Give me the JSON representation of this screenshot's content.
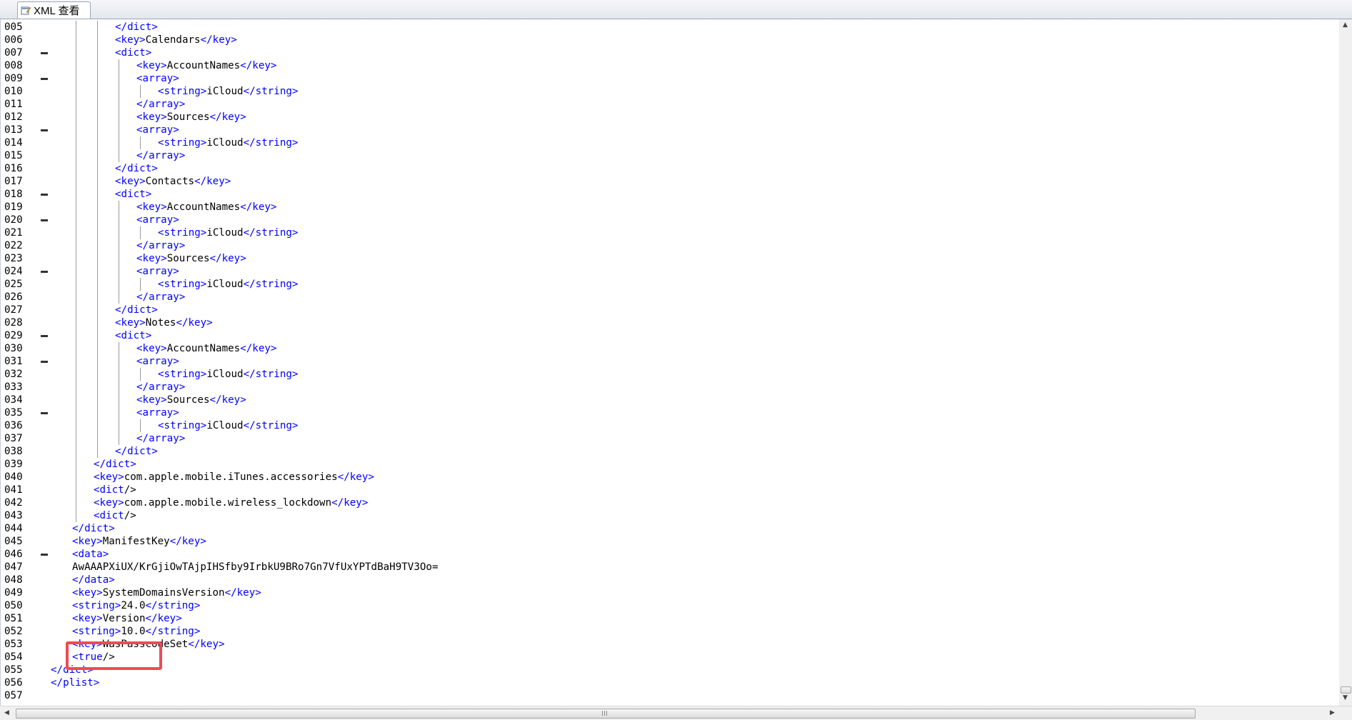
{
  "tab": {
    "label": "XML 查看",
    "icon": "document-edit-icon"
  },
  "colors": {
    "tag": "#0000ff",
    "text": "#000000",
    "highlight": "#ef4a55"
  },
  "lines": [
    {
      "num": "005",
      "indent": 5,
      "fold": false,
      "parts": [
        {
          "t": "tag",
          "v": "</dict>"
        }
      ]
    },
    {
      "num": "006",
      "indent": 5,
      "fold": false,
      "parts": [
        {
          "t": "tag",
          "v": "<key>"
        },
        {
          "t": "txt",
          "v": "Calendars"
        },
        {
          "t": "tag",
          "v": "</key>"
        }
      ]
    },
    {
      "num": "007",
      "indent": 5,
      "fold": true,
      "parts": [
        {
          "t": "tag",
          "v": "<dict>"
        }
      ]
    },
    {
      "num": "008",
      "indent": 6,
      "fold": false,
      "parts": [
        {
          "t": "tag",
          "v": "<key>"
        },
        {
          "t": "txt",
          "v": "AccountNames"
        },
        {
          "t": "tag",
          "v": "</key>"
        }
      ]
    },
    {
      "num": "009",
      "indent": 6,
      "fold": true,
      "parts": [
        {
          "t": "tag",
          "v": "<array>"
        }
      ]
    },
    {
      "num": "010",
      "indent": 7,
      "fold": false,
      "parts": [
        {
          "t": "tag",
          "v": "<string>"
        },
        {
          "t": "txt",
          "v": "iCloud"
        },
        {
          "t": "tag",
          "v": "</string>"
        }
      ]
    },
    {
      "num": "011",
      "indent": 6,
      "fold": false,
      "parts": [
        {
          "t": "tag",
          "v": "</array>"
        }
      ]
    },
    {
      "num": "012",
      "indent": 6,
      "fold": false,
      "parts": [
        {
          "t": "tag",
          "v": "<key>"
        },
        {
          "t": "txt",
          "v": "Sources"
        },
        {
          "t": "tag",
          "v": "</key>"
        }
      ]
    },
    {
      "num": "013",
      "indent": 6,
      "fold": true,
      "parts": [
        {
          "t": "tag",
          "v": "<array>"
        }
      ]
    },
    {
      "num": "014",
      "indent": 7,
      "fold": false,
      "parts": [
        {
          "t": "tag",
          "v": "<string>"
        },
        {
          "t": "txt",
          "v": "iCloud"
        },
        {
          "t": "tag",
          "v": "</string>"
        }
      ]
    },
    {
      "num": "015",
      "indent": 6,
      "fold": false,
      "parts": [
        {
          "t": "tag",
          "v": "</array>"
        }
      ]
    },
    {
      "num": "016",
      "indent": 5,
      "fold": false,
      "parts": [
        {
          "t": "tag",
          "v": "</dict>"
        }
      ]
    },
    {
      "num": "017",
      "indent": 5,
      "fold": false,
      "parts": [
        {
          "t": "tag",
          "v": "<key>"
        },
        {
          "t": "txt",
          "v": "Contacts"
        },
        {
          "t": "tag",
          "v": "</key>"
        }
      ]
    },
    {
      "num": "018",
      "indent": 5,
      "fold": true,
      "parts": [
        {
          "t": "tag",
          "v": "<dict>"
        }
      ]
    },
    {
      "num": "019",
      "indent": 6,
      "fold": false,
      "parts": [
        {
          "t": "tag",
          "v": "<key>"
        },
        {
          "t": "txt",
          "v": "AccountNames"
        },
        {
          "t": "tag",
          "v": "</key>"
        }
      ]
    },
    {
      "num": "020",
      "indent": 6,
      "fold": true,
      "parts": [
        {
          "t": "tag",
          "v": "<array>"
        }
      ]
    },
    {
      "num": "021",
      "indent": 7,
      "fold": false,
      "parts": [
        {
          "t": "tag",
          "v": "<string>"
        },
        {
          "t": "txt",
          "v": "iCloud"
        },
        {
          "t": "tag",
          "v": "</string>"
        }
      ]
    },
    {
      "num": "022",
      "indent": 6,
      "fold": false,
      "parts": [
        {
          "t": "tag",
          "v": "</array>"
        }
      ]
    },
    {
      "num": "023",
      "indent": 6,
      "fold": false,
      "parts": [
        {
          "t": "tag",
          "v": "<key>"
        },
        {
          "t": "txt",
          "v": "Sources"
        },
        {
          "t": "tag",
          "v": "</key>"
        }
      ]
    },
    {
      "num": "024",
      "indent": 6,
      "fold": true,
      "parts": [
        {
          "t": "tag",
          "v": "<array>"
        }
      ]
    },
    {
      "num": "025",
      "indent": 7,
      "fold": false,
      "parts": [
        {
          "t": "tag",
          "v": "<string>"
        },
        {
          "t": "txt",
          "v": "iCloud"
        },
        {
          "t": "tag",
          "v": "</string>"
        }
      ]
    },
    {
      "num": "026",
      "indent": 6,
      "fold": false,
      "parts": [
        {
          "t": "tag",
          "v": "</array>"
        }
      ]
    },
    {
      "num": "027",
      "indent": 5,
      "fold": false,
      "parts": [
        {
          "t": "tag",
          "v": "</dict>"
        }
      ]
    },
    {
      "num": "028",
      "indent": 5,
      "fold": false,
      "parts": [
        {
          "t": "tag",
          "v": "<key>"
        },
        {
          "t": "txt",
          "v": "Notes"
        },
        {
          "t": "tag",
          "v": "</key>"
        }
      ]
    },
    {
      "num": "029",
      "indent": 5,
      "fold": true,
      "parts": [
        {
          "t": "tag",
          "v": "<dict>"
        }
      ]
    },
    {
      "num": "030",
      "indent": 6,
      "fold": false,
      "parts": [
        {
          "t": "tag",
          "v": "<key>"
        },
        {
          "t": "txt",
          "v": "AccountNames"
        },
        {
          "t": "tag",
          "v": "</key>"
        }
      ]
    },
    {
      "num": "031",
      "indent": 6,
      "fold": true,
      "parts": [
        {
          "t": "tag",
          "v": "<array>"
        }
      ]
    },
    {
      "num": "032",
      "indent": 7,
      "fold": false,
      "parts": [
        {
          "t": "tag",
          "v": "<string>"
        },
        {
          "t": "txt",
          "v": "iCloud"
        },
        {
          "t": "tag",
          "v": "</string>"
        }
      ]
    },
    {
      "num": "033",
      "indent": 6,
      "fold": false,
      "parts": [
        {
          "t": "tag",
          "v": "</array>"
        }
      ]
    },
    {
      "num": "034",
      "indent": 6,
      "fold": false,
      "parts": [
        {
          "t": "tag",
          "v": "<key>"
        },
        {
          "t": "txt",
          "v": "Sources"
        },
        {
          "t": "tag",
          "v": "</key>"
        }
      ]
    },
    {
      "num": "035",
      "indent": 6,
      "fold": true,
      "parts": [
        {
          "t": "tag",
          "v": "<array>"
        }
      ]
    },
    {
      "num": "036",
      "indent": 7,
      "fold": false,
      "parts": [
        {
          "t": "tag",
          "v": "<string>"
        },
        {
          "t": "txt",
          "v": "iCloud"
        },
        {
          "t": "tag",
          "v": "</string>"
        }
      ]
    },
    {
      "num": "037",
      "indent": 6,
      "fold": false,
      "parts": [
        {
          "t": "tag",
          "v": "</array>"
        }
      ]
    },
    {
      "num": "038",
      "indent": 5,
      "fold": false,
      "parts": [
        {
          "t": "tag",
          "v": "</dict>"
        }
      ]
    },
    {
      "num": "039",
      "indent": 4,
      "fold": false,
      "parts": [
        {
          "t": "tag",
          "v": "</dict>"
        }
      ]
    },
    {
      "num": "040",
      "indent": 4,
      "fold": false,
      "parts": [
        {
          "t": "tag",
          "v": "<key>"
        },
        {
          "t": "txt",
          "v": "com.apple.mobile.iTunes.accessories"
        },
        {
          "t": "tag",
          "v": "</key>"
        }
      ]
    },
    {
      "num": "041",
      "indent": 4,
      "fold": false,
      "parts": [
        {
          "t": "tag",
          "v": "<dict"
        },
        {
          "t": "txt",
          "v": "/>"
        }
      ]
    },
    {
      "num": "042",
      "indent": 4,
      "fold": false,
      "parts": [
        {
          "t": "tag",
          "v": "<key>"
        },
        {
          "t": "txt",
          "v": "com.apple.mobile.wireless_lockdown"
        },
        {
          "t": "tag",
          "v": "</key>"
        }
      ]
    },
    {
      "num": "043",
      "indent": 4,
      "fold": false,
      "parts": [
        {
          "t": "tag",
          "v": "<dict"
        },
        {
          "t": "txt",
          "v": "/>"
        }
      ]
    },
    {
      "num": "044",
      "indent": 3,
      "fold": false,
      "parts": [
        {
          "t": "tag",
          "v": "</dict>"
        }
      ]
    },
    {
      "num": "045",
      "indent": 3,
      "fold": false,
      "parts": [
        {
          "t": "tag",
          "v": "<key>"
        },
        {
          "t": "txt",
          "v": "ManifestKey"
        },
        {
          "t": "tag",
          "v": "</key>"
        }
      ]
    },
    {
      "num": "046",
      "indent": 3,
      "fold": true,
      "parts": [
        {
          "t": "tag",
          "v": "<data>"
        }
      ]
    },
    {
      "num": "047",
      "indent": 3,
      "fold": false,
      "parts": [
        {
          "t": "txt",
          "v": "AwAAAPXiUX/KrGjiOwTAjpIHSfby9IrbkU9BRo7Gn7VfUxYPTdBaH9TV3Oo="
        }
      ]
    },
    {
      "num": "048",
      "indent": 3,
      "fold": false,
      "parts": [
        {
          "t": "tag",
          "v": "</data>"
        }
      ]
    },
    {
      "num": "049",
      "indent": 3,
      "fold": false,
      "parts": [
        {
          "t": "tag",
          "v": "<key>"
        },
        {
          "t": "txt",
          "v": "SystemDomainsVersion"
        },
        {
          "t": "tag",
          "v": "</key>"
        }
      ]
    },
    {
      "num": "050",
      "indent": 3,
      "fold": false,
      "parts": [
        {
          "t": "tag",
          "v": "<string>"
        },
        {
          "t": "txt",
          "v": "24.0"
        },
        {
          "t": "tag",
          "v": "</string>"
        }
      ]
    },
    {
      "num": "051",
      "indent": 3,
      "fold": false,
      "parts": [
        {
          "t": "tag",
          "v": "<key>"
        },
        {
          "t": "txt",
          "v": "Version"
        },
        {
          "t": "tag",
          "v": "</key>"
        }
      ]
    },
    {
      "num": "052",
      "indent": 3,
      "fold": false,
      "parts": [
        {
          "t": "tag",
          "v": "<string>"
        },
        {
          "t": "txt",
          "v": "10.0"
        },
        {
          "t": "tag",
          "v": "</string>"
        }
      ]
    },
    {
      "num": "053",
      "indent": 3,
      "fold": false,
      "parts": [
        {
          "t": "tag",
          "v": "<key>"
        },
        {
          "t": "txt",
          "v": "WasPasscodeSet"
        },
        {
          "t": "tag",
          "v": "</key>"
        }
      ]
    },
    {
      "num": "054",
      "indent": 3,
      "fold": false,
      "parts": [
        {
          "t": "tag",
          "v": "<true"
        },
        {
          "t": "txt",
          "v": "/>"
        }
      ]
    },
    {
      "num": "055",
      "indent": 2,
      "fold": false,
      "parts": [
        {
          "t": "tag",
          "v": "</dict>"
        }
      ]
    },
    {
      "num": "056",
      "indent": 2,
      "fold": false,
      "parts": [
        {
          "t": "tag",
          "v": "</plist>"
        }
      ]
    },
    {
      "num": "057",
      "indent": 2,
      "fold": false,
      "parts": []
    }
  ]
}
